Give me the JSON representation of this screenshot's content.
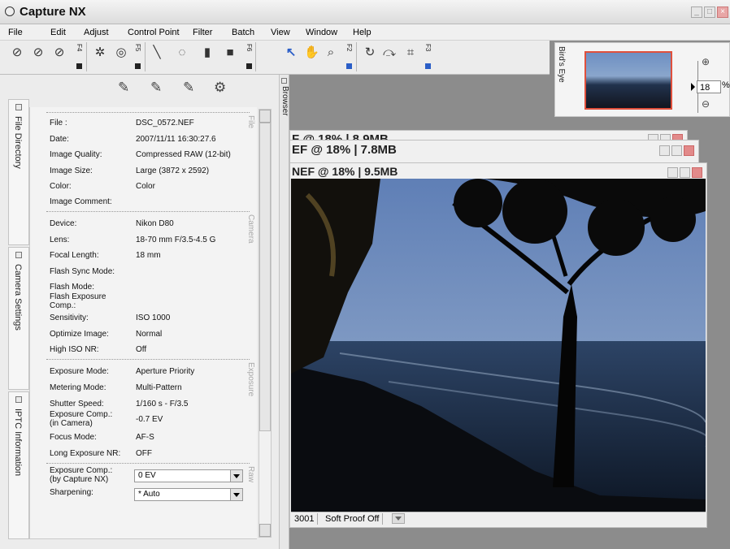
{
  "app": {
    "title": "Capture NX"
  },
  "menu": [
    "File",
    "Edit",
    "Adjust",
    "Control Point",
    "Filter",
    "Batch",
    "View",
    "Window",
    "Help"
  ],
  "toolbar": {
    "fkeys": [
      "F4",
      "F5",
      "F6",
      "F2",
      "F3"
    ]
  },
  "birds_eye": {
    "label": "Bird's Eye",
    "zoom_value": "18",
    "zoom_unit": "%"
  },
  "browser": {
    "label": "Browser"
  },
  "side_tabs": [
    "File Directory",
    "Camera Settings",
    "IPTC Information"
  ],
  "info": {
    "file_section": {
      "label": "File",
      "rows": [
        {
          "label": "File :",
          "value": "DSC_0572.NEF"
        },
        {
          "label": "Date:",
          "value": "2007/11/11 16:30:27.6"
        },
        {
          "label": "Image Quality:",
          "value": "Compressed RAW (12-bit)"
        },
        {
          "label": "Image Size:",
          "value": "Large (3872 x 2592)"
        },
        {
          "label": "Color:",
          "value": "Color"
        },
        {
          "label": "Image Comment:",
          "value": ""
        }
      ]
    },
    "camera_section": {
      "label": "Camera",
      "rows": [
        {
          "label": "Device:",
          "value": "Nikon D80"
        },
        {
          "label": "Lens:",
          "value": "18-70 mm F/3.5-4.5 G"
        },
        {
          "label": "Focal Length:",
          "value": "18 mm"
        },
        {
          "label": "Flash Sync Mode:",
          "value": ""
        },
        {
          "label": "Flash Mode:",
          "value": ""
        },
        {
          "label": "Flash Exposure Comp.:",
          "value": ""
        },
        {
          "label": "Sensitivity:",
          "value": "ISO 1000"
        },
        {
          "label": "Optimize Image:",
          "value": "Normal"
        },
        {
          "label": "High ISO NR:",
          "value": "Off"
        }
      ]
    },
    "exposure_section": {
      "label": "Exposure",
      "rows": [
        {
          "label": "Exposure Mode:",
          "value": "Aperture Priority"
        },
        {
          "label": "Metering Mode:",
          "value": "Multi-Pattern"
        },
        {
          "label": "Shutter Speed:",
          "value": "1/160 s - F/3.5"
        },
        {
          "label": "Exposure Comp.: (in Camera)",
          "value": "-0.7 EV"
        },
        {
          "label": "Focus Mode:",
          "value": "AF-S"
        },
        {
          "label": "Long Exposure NR:",
          "value": "OFF"
        }
      ]
    },
    "raw_section": {
      "label": "Raw",
      "rows": [
        {
          "label": "Exposure Comp.: (by Capture NX)",
          "value": "0 EV"
        },
        {
          "label": "Sharpening:",
          "value": "* Auto"
        }
      ]
    }
  },
  "documents": [
    {
      "title": "F @ 18% | 8.9MB"
    },
    {
      "title": "EF @ 18% | 7.8MB"
    },
    {
      "title": "NEF @ 18% | 9.5MB"
    }
  ],
  "status": {
    "left": "3001",
    "soft_proof": "Soft Proof Off"
  }
}
